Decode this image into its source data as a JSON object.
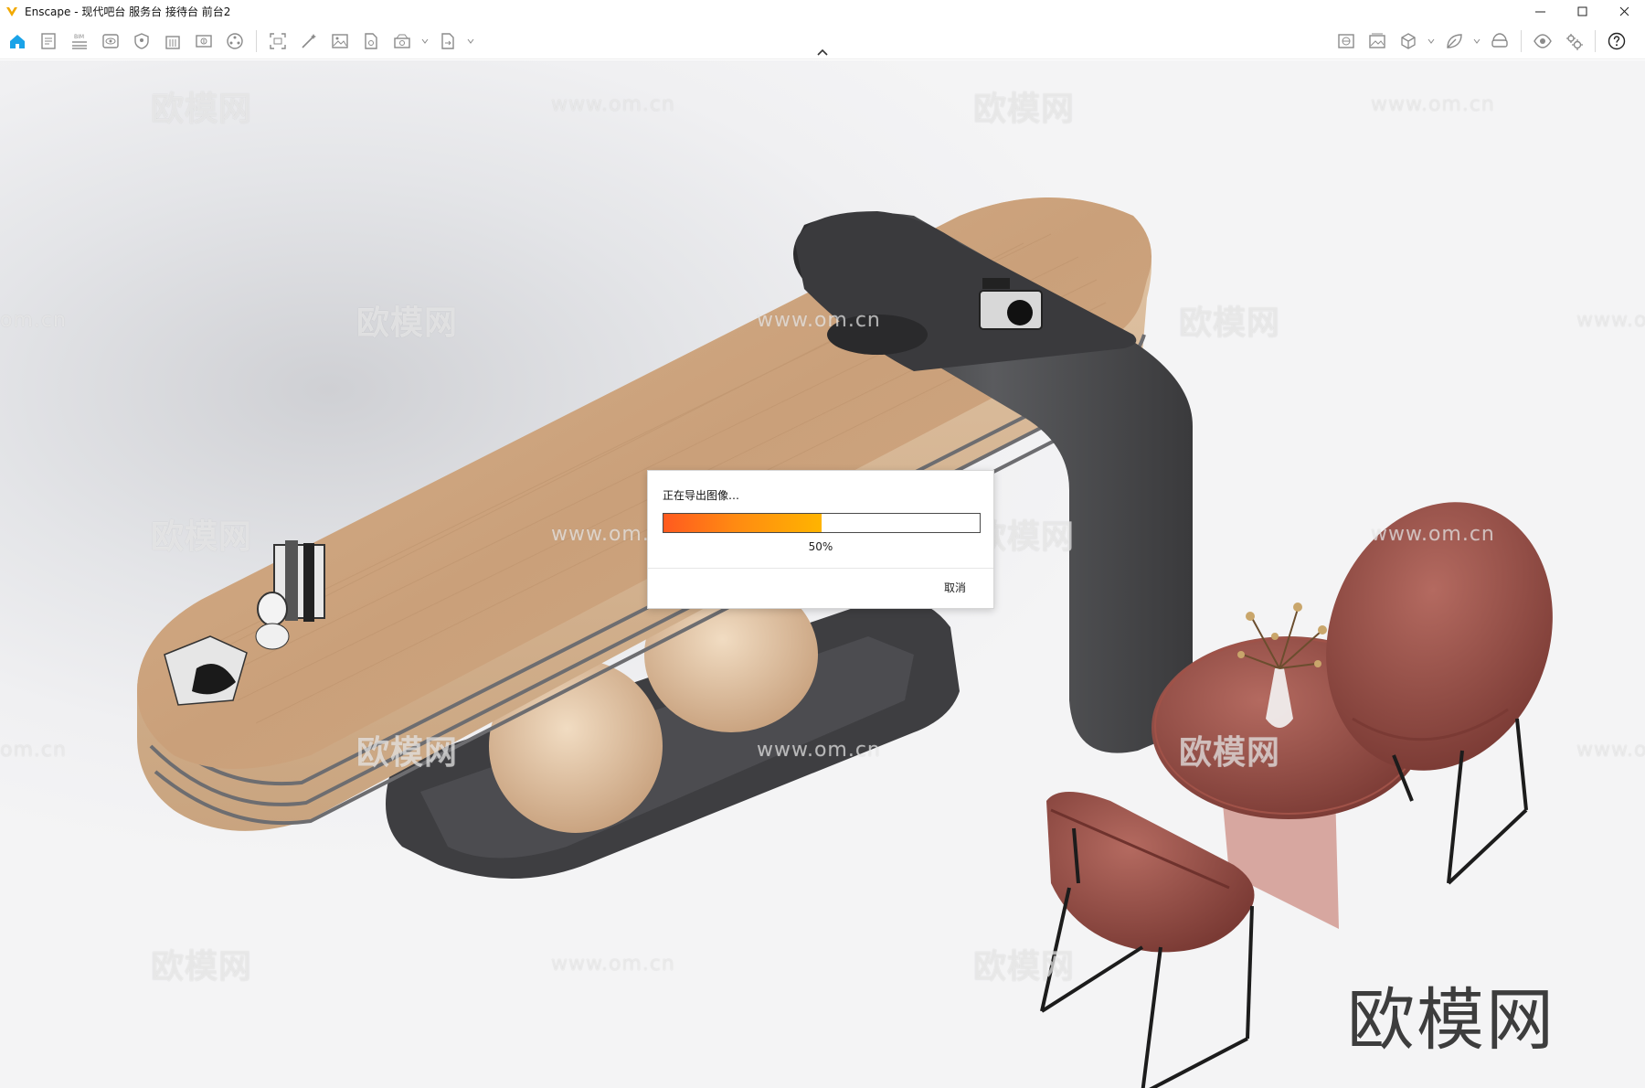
{
  "window": {
    "title": "Enscape - 现代吧台 服务台 接待台 前台2",
    "controls": [
      "minimize-icon",
      "maximize-icon",
      "close-icon"
    ]
  },
  "toolbar": {
    "left_icons": [
      "home-icon",
      "document-icon",
      "bim-icon",
      "eye-icon",
      "shield-icon",
      "building-icon",
      "book-icon",
      "asset-icon",
      "screenshot-icon",
      "magic-wand-icon",
      "image-icon",
      "file-image-icon",
      "render-batch-icon",
      "export-icon"
    ],
    "right_icons": [
      "panorama-icon",
      "gallery-icon",
      "cube-icon",
      "leaf-icon",
      "headset-icon",
      "view-icon",
      "settings-icon",
      "help-icon"
    ]
  },
  "viewport": {
    "watermarks": {
      "cn": "欧模网",
      "url": "www.om.cn",
      "url_edge": "om.cn",
      "url_edge_right": "www.o"
    },
    "brand_watermark": "欧模网"
  },
  "dialog": {
    "title": "正在导出图像…",
    "progress": 0.5,
    "percent_label": "50%",
    "cancel_label": "取消"
  },
  "colors": {
    "accent": "#1aa3e8",
    "progress_start": "#ff5a1f",
    "progress_end": "#ffb400",
    "logo": "#f2a900"
  }
}
